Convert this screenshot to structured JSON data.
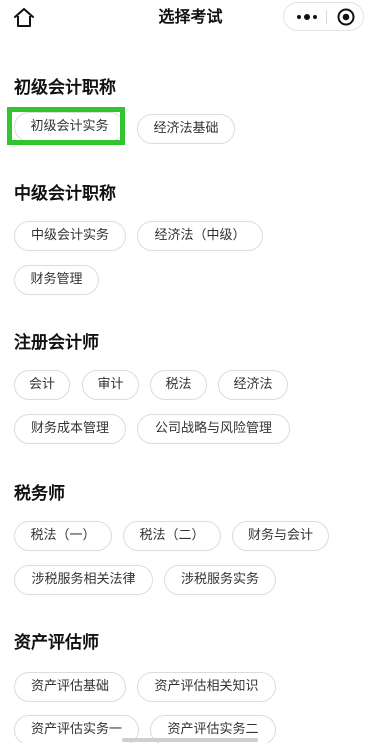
{
  "navbar": {
    "title": "选择考试",
    "home_icon": "home-icon",
    "more_icon": "more-dots-icon",
    "close_icon": "target-close-icon"
  },
  "sections": [
    {
      "title": "初级会计职称",
      "tags": [
        "初级会计实务",
        "经济法基础"
      ]
    },
    {
      "title": "中级会计职称",
      "tags": [
        "中级会计实务",
        "经济法（中级）",
        "财务管理"
      ]
    },
    {
      "title": "注册会计师",
      "tags": [
        "会计",
        "审计",
        "税法",
        "经济法",
        "财务成本管理",
        "公司战略与风险管理"
      ]
    },
    {
      "title": "税务师",
      "tags": [
        "税法（一）",
        "税法（二）",
        "财务与会计",
        "涉税服务相关法律",
        "涉税服务实务"
      ]
    },
    {
      "title": "资产评估师",
      "tags": [
        "资产评估基础",
        "资产评估相关知识",
        "资产评估实务一",
        "资产评估实务二"
      ]
    }
  ],
  "selected": "初级会计实务",
  "colors": {
    "highlight": "#33c42f",
    "tag_border": "#dcdcdc",
    "tag_text": "#333333",
    "title_text": "#111111"
  }
}
